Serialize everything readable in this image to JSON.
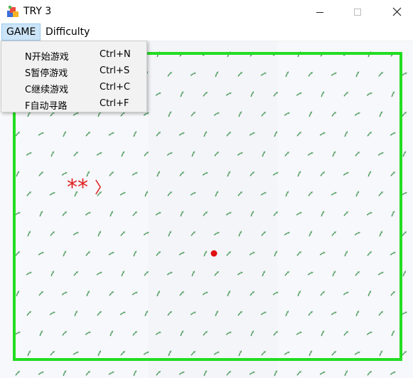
{
  "window": {
    "title": "TRY 3"
  },
  "menubar": {
    "items": [
      {
        "label": "GAME",
        "active": true
      },
      {
        "label": "Difficulty",
        "active": false
      }
    ]
  },
  "game_menu": {
    "items": [
      {
        "label": "N开始游戏",
        "shortcut": "Ctrl+N"
      },
      {
        "label": "S暂停游戏",
        "shortcut": "Ctrl+S"
      },
      {
        "label": "C继续游戏",
        "shortcut": "Ctrl+C"
      },
      {
        "label": "F自动寻路",
        "shortcut": "Ctrl+F"
      }
    ]
  },
  "board": {
    "border_color": "#22dd22",
    "snake_text": "**",
    "snake_head": "〉",
    "snake_color": "#e02020",
    "food_color": "#e01010",
    "background_color": "#f6f7fa",
    "pattern_color": "#4a9a5a"
  },
  "icons": {
    "app": "app-icon",
    "minimize": "minimize-icon",
    "maximize": "maximize-icon",
    "close": "close-icon"
  }
}
